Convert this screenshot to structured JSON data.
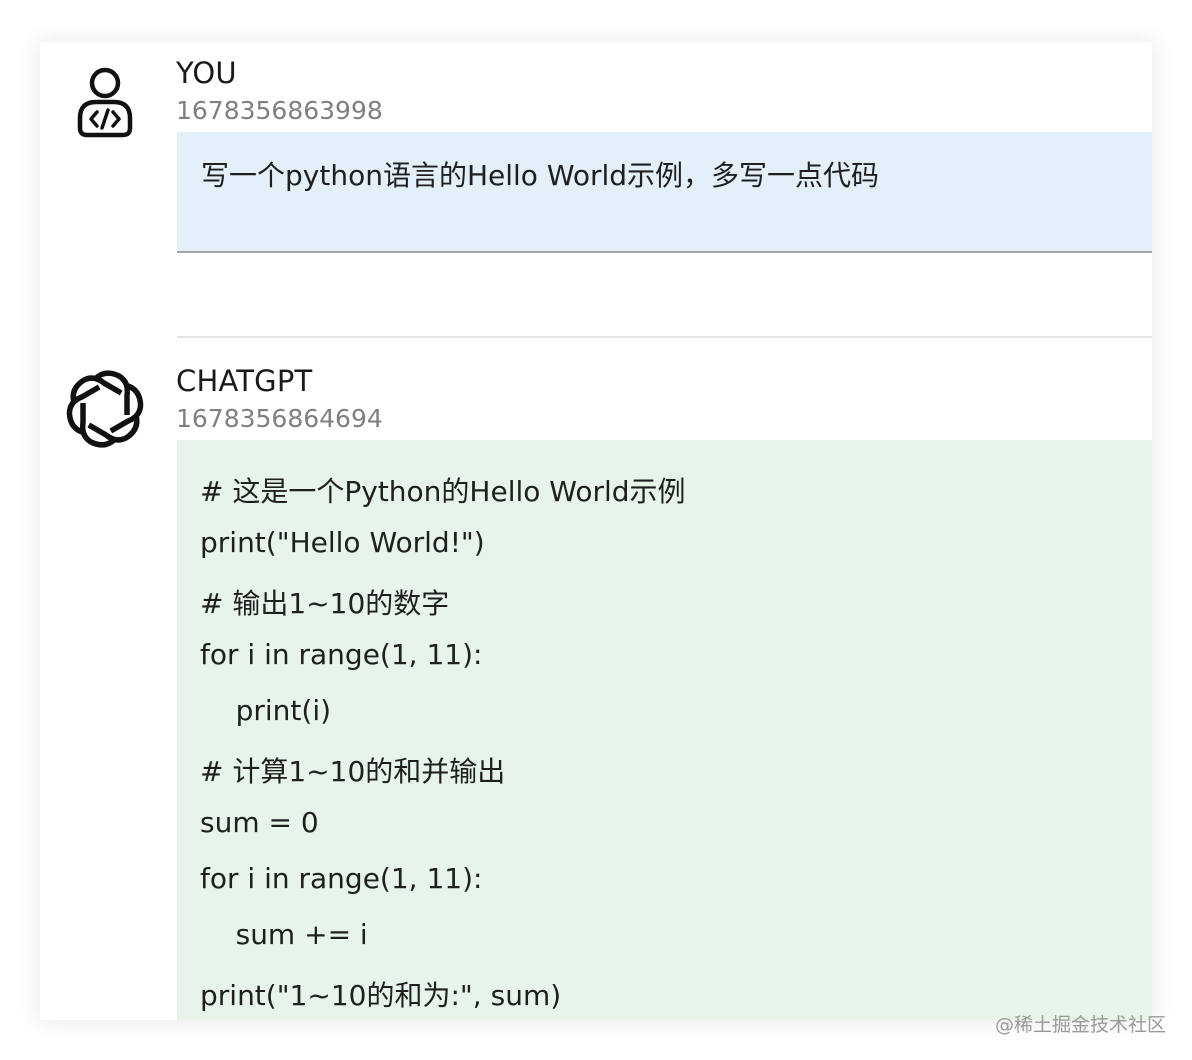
{
  "messages": [
    {
      "author": "YOU",
      "timestamp": "1678356863998",
      "avatar_icon": "user-code-icon",
      "text": "写一个python语言的Hello World示例，多写一点代码"
    },
    {
      "author": "CHATGPT",
      "timestamp": "1678356864694",
      "avatar_icon": "openai-logo-icon",
      "code_lines": [
        "# 这是一个Python的Hello World示例",
        "print(\"Hello World!\")",
        "# 输出1~10的数字",
        "for i in range(1, 11):",
        "    print(i)",
        "# 计算1~10的和并输出",
        "sum = 0",
        "for i in range(1, 11):",
        "    sum += i",
        "print(\"1~10的和为:\", sum)"
      ]
    }
  ],
  "watermark": "@稀土掘金技术社区",
  "colors": {
    "user_bubble": "#e3eff9",
    "bot_bubble": "#e7f4e9",
    "timestamp": "#808080"
  }
}
